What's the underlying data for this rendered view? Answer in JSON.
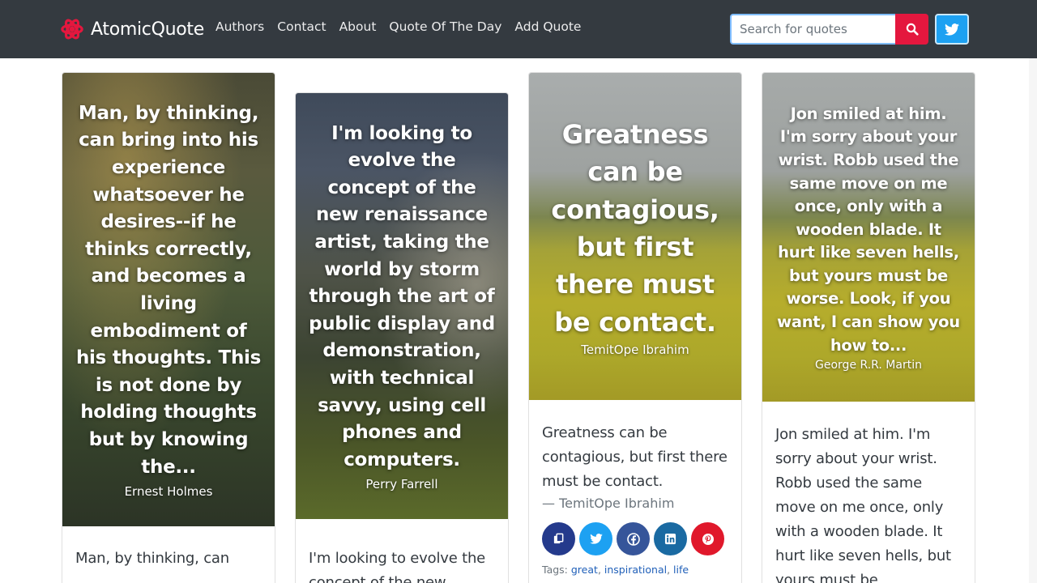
{
  "brand": {
    "name": "AtomicQuote",
    "logo_icon": "atom-icon",
    "accent": "#e4173e"
  },
  "nav": [
    {
      "label": "Authors"
    },
    {
      "label": "Contact"
    },
    {
      "label": "About"
    },
    {
      "label": "Quote Of The Day"
    },
    {
      "label": "Add Quote"
    }
  ],
  "search": {
    "placeholder": "Search for quotes",
    "value": "",
    "button_icon": "search-icon"
  },
  "social": {
    "twitter_icon": "twitter-icon",
    "twitter_color": "#1da1f2"
  },
  "cards": [
    {
      "image_quote": "Man, by thinking, can bring into his experience whatsoever he desires--if he thinks correctly, and becomes a living embodiment of his thoughts. This is not done by holding thoughts but by knowing the...",
      "image_author": "Ernest Holmes",
      "text": "Man, by thinking, can"
    },
    {
      "image_quote": "I'm looking to evolve the concept of the new renaissance artist, taking the world by storm through the art of public display and demonstration, with technical savvy, using cell phones and computers.",
      "image_author": "Perry Farrell",
      "text": "I'm looking to evolve the concept of the new"
    },
    {
      "image_quote": "Greatness can be contagious, but first there must be contact.",
      "image_author": "TemitOpe Ibrahim",
      "text": "Greatness can be contagious, but first there must be contact.",
      "author_line": "— TemitOpe Ibrahim",
      "share": [
        "copy-icon",
        "twitter-icon",
        "facebook-icon",
        "linkedin-icon",
        "pinterest-icon"
      ],
      "tags_label": "Tags:",
      "tags": [
        "great",
        "inspirational",
        "life"
      ]
    },
    {
      "image_quote": "Jon smiled at him. I'm sorry about your wrist. Robb used the same move on me once, only with a wooden blade. It hurt like seven hells, but yours must be worse. Look, if you want, I can show you how to...",
      "image_author": "George R.R. Martin",
      "text": "Jon smiled at him. I'm sorry about your wrist. Robb used the same move on me once, only with a wooden blade. It hurt like seven hells, but yours must be"
    }
  ]
}
